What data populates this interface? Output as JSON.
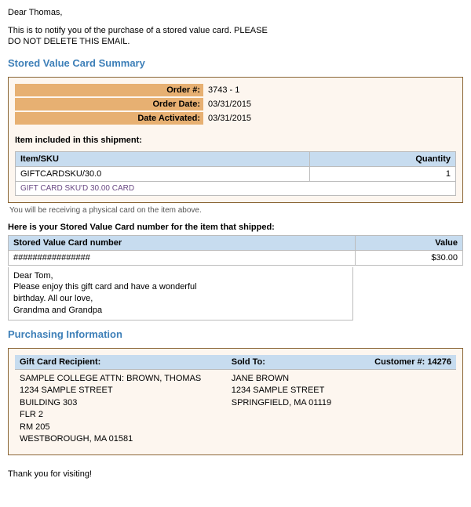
{
  "greeting": "Dear Thomas,",
  "notice": "This is to notify you of the purchase of a stored value card. PLEASE DO NOT DELETE THIS EMAIL.",
  "sections": {
    "summary_title": "Stored Value Card Summary",
    "purchasing_title": "Purchasing Information"
  },
  "order": {
    "labels": {
      "order_no": "Order #:",
      "order_date": "Order Date:",
      "activated": "Date Activated:"
    },
    "order_no": "3743 - 1",
    "order_date": "03/31/2015",
    "activated": "03/31/2015"
  },
  "shipment_header": "Item included in this shipment:",
  "item_table": {
    "head_item": "Item/SKU",
    "head_qty": "Quantity",
    "sku": "GIFTCARDSKU/30.0",
    "qty": "1",
    "desc": "GIFT CARD SKU'D 30.00 CARD"
  },
  "footnote": "You will be receiving a physical card on the item above.",
  "svc": {
    "intro": "Here is your Stored Value Card number for the item that shipped:",
    "head_num": "Stored Value Card number",
    "head_val": "Value",
    "number": "################",
    "value": "$30.00"
  },
  "message": {
    "l1": "Dear Tom,",
    "l2": "Please enjoy this gift card and have a wonderful",
    "l3": "birthday. All our love,",
    "l4": "Grandma and Grandpa"
  },
  "purchase": {
    "recipient_label": "Gift Card Recipient:",
    "sold_label": "Sold To:",
    "customer_label": "Customer #:",
    "customer_no": "14276",
    "recipient": {
      "l1": "SAMPLE COLLEGE ATTN: BROWN, THOMAS",
      "l2": "1234 SAMPLE STREET",
      "l3": "BUILDING 303",
      "l4": "FLR 2",
      "l5": "RM 205",
      "l6": "WESTBOROUGH, MA 01581"
    },
    "sold_to": {
      "l1": "JANE BROWN",
      "l2": "1234 SAMPLE STREET",
      "l3": "SPRINGFIELD, MA 01119"
    }
  },
  "thanks": "Thank you for visiting!"
}
